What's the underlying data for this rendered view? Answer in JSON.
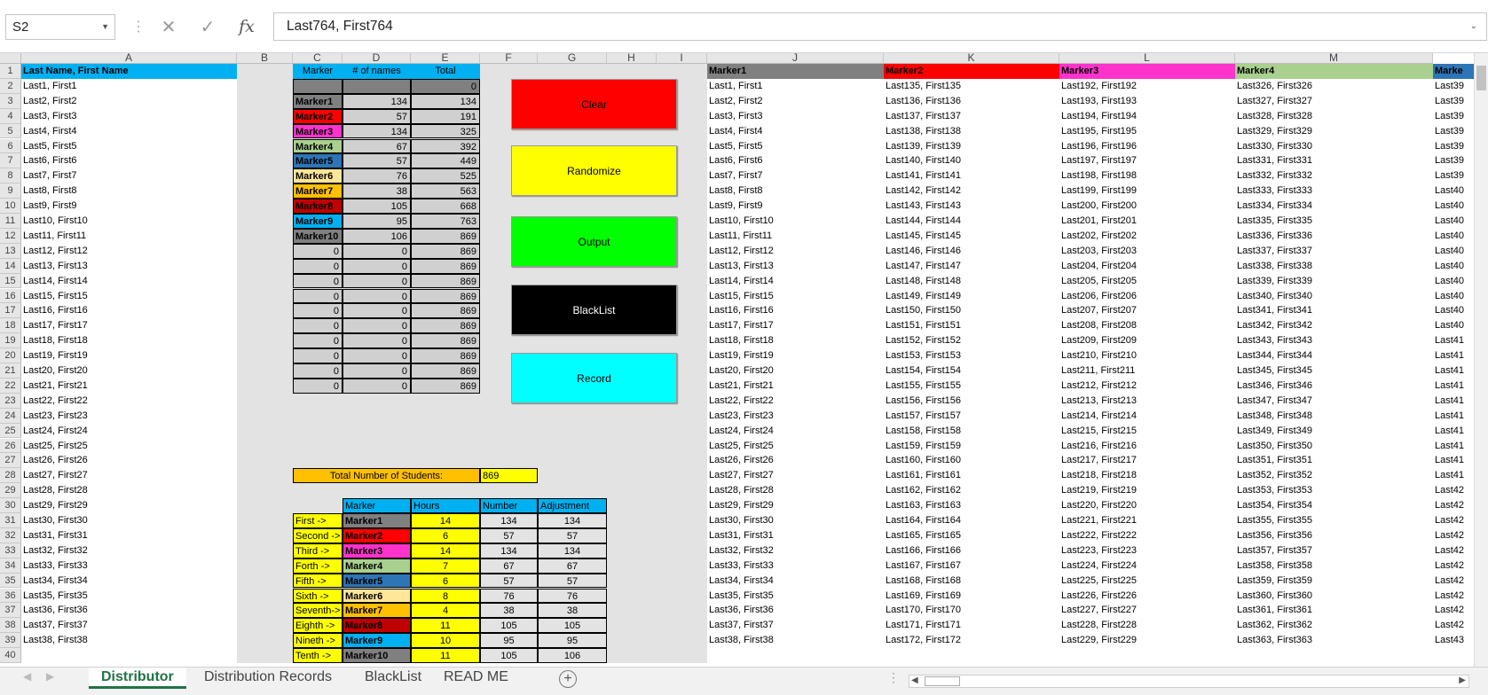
{
  "namebox": "S2",
  "formula": "Last764, First764",
  "toolbar": {
    "cancel_icon": "close-icon",
    "enter_icon": "check-icon",
    "fx_label": "fx"
  },
  "columns": [
    "A",
    "B",
    "C",
    "D",
    "E",
    "F",
    "G",
    "H",
    "I",
    "J",
    "K",
    "L",
    "M"
  ],
  "header_row": {
    "A": "Last Name, First Name",
    "C": "Marker",
    "D": "# of names",
    "E": "Total",
    "J": "Marker1",
    "K": "Marker2",
    "L": "Marker3",
    "M": "Marker4",
    "N": "Marke"
  },
  "e2": "0",
  "marker_table": [
    {
      "name": "Marker1",
      "names": "134",
      "total": "134",
      "color": "#808080"
    },
    {
      "name": "Marker2",
      "names": "57",
      "total": "191",
      "color": "#ff0000"
    },
    {
      "name": "Marker3",
      "names": "134",
      "total": "325",
      "color": "#ff33cc"
    },
    {
      "name": "Marker4",
      "names": "67",
      "total": "392",
      "color": "#a9d08e"
    },
    {
      "name": "Marker5",
      "names": "57",
      "total": "449",
      "color": "#2e75b6"
    },
    {
      "name": "Marker6",
      "names": "76",
      "total": "525",
      "color": "#ffe699"
    },
    {
      "name": "Marker7",
      "names": "38",
      "total": "563",
      "color": "#ffc000"
    },
    {
      "name": "Marker8",
      "names": "105",
      "total": "668",
      "color": "#c00000"
    },
    {
      "name": "Marker9",
      "names": "95",
      "total": "763",
      "color": "#00b0f0"
    },
    {
      "name": "Marker10",
      "names": "106",
      "total": "869",
      "color": "#808080"
    },
    {
      "name": "0",
      "names": "0",
      "total": "869",
      "color": ""
    },
    {
      "name": "0",
      "names": "0",
      "total": "869",
      "color": ""
    },
    {
      "name": "0",
      "names": "0",
      "total": "869",
      "color": ""
    },
    {
      "name": "0",
      "names": "0",
      "total": "869",
      "color": ""
    },
    {
      "name": "0",
      "names": "0",
      "total": "869",
      "color": ""
    },
    {
      "name": "0",
      "names": "0",
      "total": "869",
      "color": ""
    },
    {
      "name": "0",
      "names": "0",
      "total": "869",
      "color": ""
    },
    {
      "name": "0",
      "names": "0",
      "total": "869",
      "color": ""
    },
    {
      "name": "0",
      "names": "0",
      "total": "869",
      "color": ""
    },
    {
      "name": "0",
      "names": "0",
      "total": "869",
      "color": ""
    }
  ],
  "total_students": {
    "label": "Total Number of Students:",
    "value": "869"
  },
  "hours_header": {
    "marker": "Marker",
    "hours": "Hours",
    "number": "Number",
    "adjustment": "Adjustment"
  },
  "hours_table": [
    {
      "order": "First ->",
      "marker": "Marker1",
      "hours": "14",
      "number": "134",
      "adj": "134",
      "color": "#808080"
    },
    {
      "order": "Second ->",
      "marker": "Marker2",
      "hours": "6",
      "number": "57",
      "adj": "57",
      "color": "#ff0000"
    },
    {
      "order": "Third ->",
      "marker": "Marker3",
      "hours": "14",
      "number": "134",
      "adj": "134",
      "color": "#ff33cc"
    },
    {
      "order": "Forth ->",
      "marker": "Marker4",
      "hours": "7",
      "number": "67",
      "adj": "67",
      "color": "#a9d08e"
    },
    {
      "order": "Fifth ->",
      "marker": "Marker5",
      "hours": "6",
      "number": "57",
      "adj": "57",
      "color": "#2e75b6"
    },
    {
      "order": "Sixth ->",
      "marker": "Marker6",
      "hours": "8",
      "number": "76",
      "adj": "76",
      "color": "#ffe699"
    },
    {
      "order": "Seventh->",
      "marker": "Marker7",
      "hours": "4",
      "number": "38",
      "adj": "38",
      "color": "#ffc000"
    },
    {
      "order": "Eighth ->",
      "marker": "Marker8",
      "hours": "11",
      "number": "105",
      "adj": "105",
      "color": "#c00000"
    },
    {
      "order": "Nineth ->",
      "marker": "Marker9",
      "hours": "10",
      "number": "95",
      "adj": "95",
      "color": "#00b0f0"
    },
    {
      "order": "Tenth ->",
      "marker": "Marker10",
      "hours": "11",
      "number": "105",
      "adj": "106",
      "color": "#808080"
    }
  ],
  "buttons": [
    {
      "label": "Clear",
      "color": "#ff0000",
      "text": "#000"
    },
    {
      "label": "Randomize",
      "color": "#ffff00",
      "text": "#000"
    },
    {
      "label": "Output",
      "color": "#00ff00",
      "text": "#000"
    },
    {
      "label": "BlackList",
      "color": "#000000",
      "text": "#ffffff"
    },
    {
      "label": "Record",
      "color": "#00ffff",
      "text": "#000"
    }
  ],
  "col_a": [
    "Last1, First1",
    "Last2, First2",
    "Last3, First3",
    "Last4, First4",
    "Last5, First5",
    "Last6, First6",
    "Last7, First7",
    "Last8, First8",
    "Last9, First9",
    "Last10, First10",
    "Last11, First11",
    "Last12, First12",
    "Last13, First13",
    "Last14, First14",
    "Last15, First15",
    "Last16, First16",
    "Last17, First17",
    "Last18, First18",
    "Last19, First19",
    "Last20, First20",
    "Last21, First21",
    "Last22, First22",
    "Last23, First23",
    "Last24, First24",
    "Last25, First25",
    "Last26, First26",
    "Last27, First27",
    "Last28, First28",
    "Last29, First29",
    "Last30, First30",
    "Last31, First31",
    "Last32, First32",
    "Last33, First33",
    "Last34, First34",
    "Last35, First35",
    "Last36, First36",
    "Last37, First37",
    "Last38, First38"
  ],
  "col_j": [
    "Last1, First1",
    "Last2, First2",
    "Last3, First3",
    "Last4, First4",
    "Last5, First5",
    "Last6, First6",
    "Last7, First7",
    "Last8, First8",
    "Last9, First9",
    "Last10, First10",
    "Last11, First11",
    "Last12, First12",
    "Last13, First13",
    "Last14, First14",
    "Last15, First15",
    "Last16, First16",
    "Last17, First17",
    "Last18, First18",
    "Last19, First19",
    "Last20, First20",
    "Last21, First21",
    "Last22, First22",
    "Last23, First23",
    "Last24, First24",
    "Last25, First25",
    "Last26, First26",
    "Last27, First27",
    "Last28, First28",
    "Last29, First29",
    "Last30, First30",
    "Last31, First31",
    "Last32, First32",
    "Last33, First33",
    "Last34, First34",
    "Last35, First35",
    "Last36, First36",
    "Last37, First37",
    "Last38, First38"
  ],
  "col_k": [
    "Last135, First135",
    "Last136, First136",
    "Last137, First137",
    "Last138, First138",
    "Last139, First139",
    "Last140, First140",
    "Last141, First141",
    "Last142, First142",
    "Last143, First143",
    "Last144, First144",
    "Last145, First145",
    "Last146, First146",
    "Last147, First147",
    "Last148, First148",
    "Last149, First149",
    "Last150, First150",
    "Last151, First151",
    "Last152, First152",
    "Last153, First153",
    "Last154, First154",
    "Last155, First155",
    "Last156, First156",
    "Last157, First157",
    "Last158, First158",
    "Last159, First159",
    "Last160, First160",
    "Last161, First161",
    "Last162, First162",
    "Last163, First163",
    "Last164, First164",
    "Last165, First165",
    "Last166, First166",
    "Last167, First167",
    "Last168, First168",
    "Last169, First169",
    "Last170, First170",
    "Last171, First171",
    "Last172, First172"
  ],
  "col_l": [
    "Last192, First192",
    "Last193, First193",
    "Last194, First194",
    "Last195, First195",
    "Last196, First196",
    "Last197, First197",
    "Last198, First198",
    "Last199, First199",
    "Last200, First200",
    "Last201, First201",
    "Last202, First202",
    "Last203, First203",
    "Last204, First204",
    "Last205, First205",
    "Last206, First206",
    "Last207, First207",
    "Last208, First208",
    "Last209, First209",
    "Last210, First210",
    "Last211, First211",
    "Last212, First212",
    "Last213, First213",
    "Last214, First214",
    "Last215, First215",
    "Last216, First216",
    "Last217, First217",
    "Last218, First218",
    "Last219, First219",
    "Last220, First220",
    "Last221, First221",
    "Last222, First222",
    "Last223, First223",
    "Last224, First224",
    "Last225, First225",
    "Last226, First226",
    "Last227, First227",
    "Last228, First228",
    "Last229, First229"
  ],
  "col_m": [
    "Last326, First326",
    "Last327, First327",
    "Last328, First328",
    "Last329, First329",
    "Last330, First330",
    "Last331, First331",
    "Last332, First332",
    "Last333, First333",
    "Last334, First334",
    "Last335, First335",
    "Last336, First336",
    "Last337, First337",
    "Last338, First338",
    "Last339, First339",
    "Last340, First340",
    "Last341, First341",
    "Last342, First342",
    "Last343, First343",
    "Last344, First344",
    "Last345, First345",
    "Last346, First346",
    "Last347, First347",
    "Last348, First348",
    "Last349, First349",
    "Last350, First350",
    "Last351, First351",
    "Last352, First352",
    "Last353, First353",
    "Last354, First354",
    "Last355, First355",
    "Last356, First356",
    "Last357, First357",
    "Last358, First358",
    "Last359, First359",
    "Last360, First360",
    "Last361, First361",
    "Last362, First362",
    "Last363, First363"
  ],
  "col_n": [
    "Last39",
    "Last39",
    "Last39",
    "Last39",
    "Last39",
    "Last39",
    "Last39",
    "Last40",
    "Last40",
    "Last40",
    "Last40",
    "Last40",
    "Last40",
    "Last40",
    "Last40",
    "Last40",
    "Last40",
    "Last41",
    "Last41",
    "Last41",
    "Last41",
    "Last41",
    "Last41",
    "Last41",
    "Last41",
    "Last41",
    "Last41",
    "Last42",
    "Last42",
    "Last42",
    "Last42",
    "Last42",
    "Last42",
    "Last42",
    "Last42",
    "Last42",
    "Last42",
    "Last43"
  ],
  "tabs": [
    "Distributor",
    "Distribution Records",
    "BlackList",
    "READ ME"
  ],
  "active_tab": "Distributor"
}
